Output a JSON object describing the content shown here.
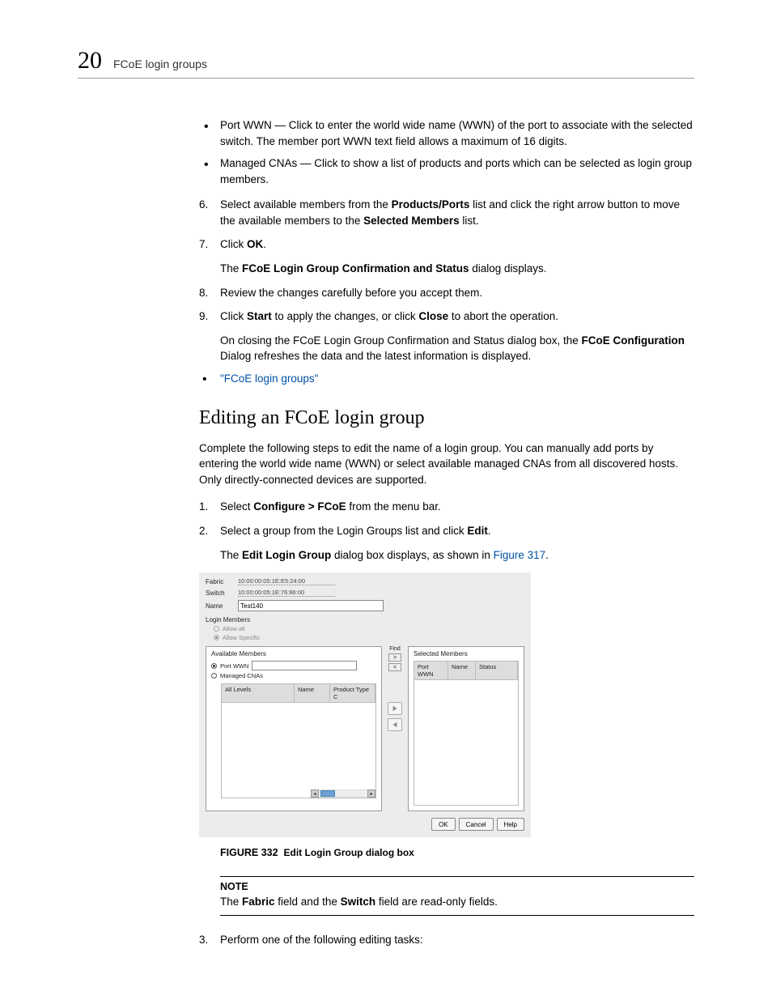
{
  "header": {
    "chapter_number": "20",
    "chapter_title": "FCoE login groups"
  },
  "top_bullets": [
    {
      "text_before": "Port WWN — Click to enter the world wide name (WWN) of the port to associate with the selected switch. The member port WWN text field allows a maximum of 16 digits."
    },
    {
      "text_before": "Managed CNAs — Click to show a list of products and ports which can be selected as login group members."
    }
  ],
  "steps_a": [
    {
      "num": "6.",
      "parts": [
        {
          "t": "Select available members from the "
        },
        {
          "t": "Products/Ports",
          "b": true
        },
        {
          "t": " list and click the right arrow button to move the available members to the "
        },
        {
          "t": "Selected Members",
          "b": true
        },
        {
          "t": " list."
        }
      ]
    },
    {
      "num": "7.",
      "parts": [
        {
          "t": "Click "
        },
        {
          "t": "OK",
          "b": true
        },
        {
          "t": "."
        }
      ],
      "follow": [
        {
          "t": "The "
        },
        {
          "t": "FCoE Login Group Confirmation and Status",
          "b": true
        },
        {
          "t": " dialog displays."
        }
      ]
    },
    {
      "num": "8.",
      "parts": [
        {
          "t": "Review the changes carefully before you accept them."
        }
      ]
    },
    {
      "num": "9.",
      "parts": [
        {
          "t": "Click "
        },
        {
          "t": "Start",
          "b": true
        },
        {
          "t": " to apply the changes, or click "
        },
        {
          "t": "Close",
          "b": true
        },
        {
          "t": " to abort the operation."
        }
      ],
      "follow": [
        {
          "t": "On closing the FCoE Login Group Confirmation and Status dialog box, the "
        },
        {
          "t": "FCoE Configuration",
          "b": true
        },
        {
          "t": " Dialog refreshes the data and the latest information is displayed."
        }
      ]
    }
  ],
  "toc_link": "\"FCoE login groups\"",
  "section_heading": "Editing an FCoE login group",
  "section_intro": "Complete the following steps to edit the name of a login group. You can manually add ports by entering the world wide name (WWN) or select available managed CNAs from all discovered hosts. Only directly-connected devices are supported.",
  "steps_b": [
    {
      "num": "1.",
      "parts": [
        {
          "t": "Select "
        },
        {
          "t": "Configure > FCoE",
          "b": true
        },
        {
          "t": " from the menu bar."
        }
      ]
    },
    {
      "num": "2.",
      "parts": [
        {
          "t": "Select a group from the Login Groups list and click "
        },
        {
          "t": "Edit",
          "b": true
        },
        {
          "t": "."
        }
      ],
      "follow": [
        {
          "t": "The "
        },
        {
          "t": "Edit Login Group",
          "b": true
        },
        {
          "t": " dialog box displays, as shown in "
        },
        {
          "t": "Figure 317",
          "link": true
        },
        {
          "t": "."
        }
      ]
    }
  ],
  "dialog": {
    "fabric_label": "Fabric",
    "fabric_value": "10:00:00:05:1E:E5:24:00",
    "switch_label": "Switch",
    "switch_value": "10:00:00:05:1E:76:86:00",
    "name_label": "Name",
    "name_value": "Test140",
    "login_members_label": "Login Members",
    "allow_all_label": "Allow all",
    "allow_specific_label": "Allow Specific",
    "available_members_label": "Available Members",
    "port_wwn_label": "Port WWN",
    "managed_cnas_label": "Managed CNAs",
    "col_all_levels": "All Levels",
    "col_name": "Name",
    "col_product_type": "Product Type C",
    "find_label": "Find",
    "find_gt": ">",
    "find_lt": "<",
    "selected_members_label": "Selected Members",
    "col_port_wwn": "Port WWN",
    "col_name2": "Name",
    "col_status": "Status",
    "btn_ok": "OK",
    "btn_cancel": "Cancel",
    "btn_help": "Help"
  },
  "figure_caption": {
    "label": "FIGURE 332",
    "text": "Edit Login Group dialog box"
  },
  "note": {
    "title": "NOTE",
    "parts": [
      {
        "t": "The "
      },
      {
        "t": "Fabric",
        "b": true
      },
      {
        "t": " field and the "
      },
      {
        "t": "Switch",
        "b": true
      },
      {
        "t": " field are read-only fields."
      }
    ]
  },
  "step3": {
    "num": "3.",
    "parts": [
      {
        "t": "Perform one of the following editing tasks:"
      }
    ]
  }
}
